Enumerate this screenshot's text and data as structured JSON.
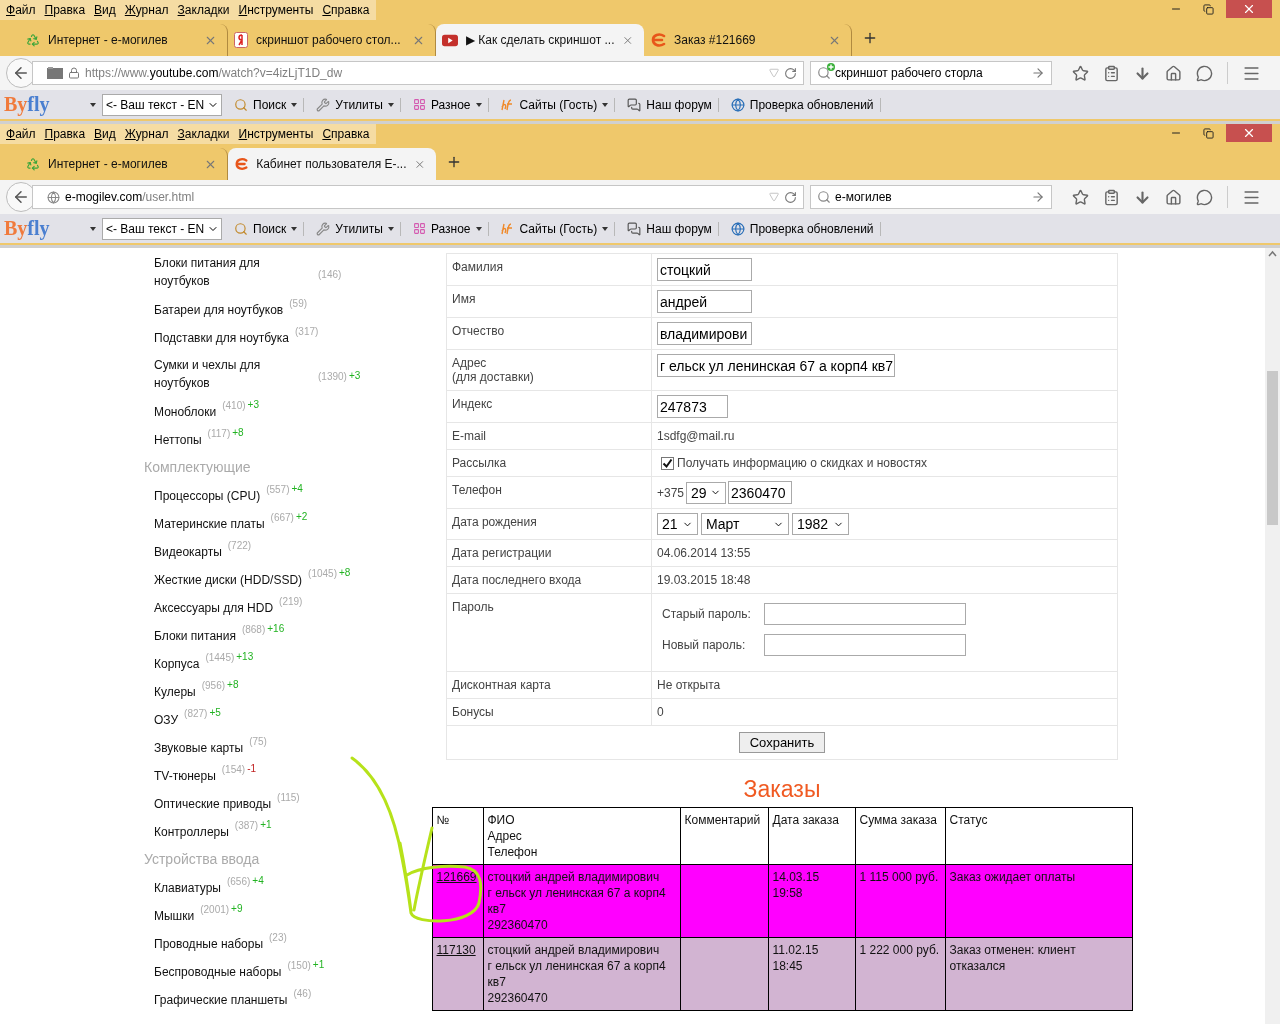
{
  "browsers": [
    {
      "menu": [
        "Файл",
        "Правка",
        "Вид",
        "Журнал",
        "Закладки",
        "Инструменты",
        "Справка"
      ],
      "tabs": [
        {
          "title": "Интернет - е-могилев",
          "kind": "recycle",
          "selected": false
        },
        {
          "title": "скриншот рабочего стол...",
          "kind": "yandex",
          "selected": false
        },
        {
          "title": "▶ Как сделать скриншот ...",
          "kind": "video",
          "selected": true
        },
        {
          "title": "Заказ #121669",
          "kind": "shop",
          "selected": false
        }
      ],
      "address": {
        "kind": "secure",
        "prefix": "https://www.",
        "host": "youtube.com",
        "path": "/watch?v=4izLjT1D_dw"
      },
      "search": {
        "kind": "add",
        "value": "скриншот рабочего сторла"
      },
      "bookmarks": {
        "logo": [
          "By",
          "fly"
        ],
        "select": "<- Ваш текст - EN",
        "items": [
          {
            "label": "Поиск",
            "kind": "search",
            "dropdown": true
          },
          {
            "label": "Утилиты",
            "kind": "tools",
            "dropdown": true
          },
          {
            "label": "Разное",
            "kind": "grid",
            "dropdown": true
          },
          {
            "label": "Сайты (Гость)",
            "kind": "bf",
            "dropdown": true
          },
          {
            "label": "Наш форум",
            "kind": "chat",
            "dropdown": false
          },
          {
            "label": "Проверка обновлений",
            "kind": "globe",
            "dropdown": false
          }
        ]
      }
    },
    {
      "menu": [
        "Файл",
        "Правка",
        "Вид",
        "Журнал",
        "Закладки",
        "Инструменты",
        "Справка"
      ],
      "tabs": [
        {
          "title": "Интернет - е-могилев",
          "kind": "recycle",
          "selected": false
        },
        {
          "title": "Кабинет пользователя Е-...",
          "kind": "shop",
          "selected": true
        }
      ],
      "address": {
        "kind": "plain",
        "host": "e-mogilev.com",
        "path": "/user.html"
      },
      "search": {
        "kind": "plain",
        "value": "е-могилев"
      },
      "bookmarks": {
        "logo": [
          "By",
          "fly"
        ],
        "select": "<- Ваш текст - EN",
        "items": [
          {
            "label": "Поиск",
            "kind": "search",
            "dropdown": true
          },
          {
            "label": "Утилиты",
            "kind": "tools",
            "dropdown": true
          },
          {
            "label": "Разное",
            "kind": "grid",
            "dropdown": true
          },
          {
            "label": "Сайты (Гость)",
            "kind": "bf",
            "dropdown": true
          },
          {
            "label": "Наш форум",
            "kind": "chat",
            "dropdown": false
          },
          {
            "label": "Проверка обновлений",
            "kind": "globe",
            "dropdown": false
          }
        ]
      }
    }
  ],
  "sidebar": [
    {
      "items": [
        {
          "name": "Блоки питания для ноутбуков",
          "count": "(146)"
        },
        {
          "name": "Батареи для ноутбуков",
          "count": "(59)"
        },
        {
          "name": "Подставки для ноутбука",
          "count": "(317)"
        },
        {
          "name": "Сумки и чехлы для ноутбуков",
          "count": "(1390)",
          "delta": "+3",
          "kind": "up"
        },
        {
          "name": "Моноблоки",
          "count": "(410)",
          "delta": "+3",
          "kind": "up"
        },
        {
          "name": "Неттопы",
          "count": "(117)",
          "delta": "+8",
          "kind": "up"
        }
      ]
    },
    {
      "title": "Комплектующие",
      "items": [
        {
          "name": "Процессоры (CPU)",
          "count": "(557)",
          "delta": "+4",
          "kind": "up"
        },
        {
          "name": "Материнские платы",
          "count": "(667)",
          "delta": "+2",
          "kind": "up"
        },
        {
          "name": "Видеокарты",
          "count": "(722)"
        },
        {
          "name": "Жесткие диски (HDD/SSD)",
          "count": "(1045)",
          "delta": "+8",
          "kind": "up"
        },
        {
          "name": "Аксессуары для HDD",
          "count": "(219)"
        },
        {
          "name": "Блоки питания",
          "count": "(868)",
          "delta": "+16",
          "kind": "up"
        },
        {
          "name": "Корпуса",
          "count": "(1445)",
          "delta": "+13",
          "kind": "up"
        },
        {
          "name": "Кулеры",
          "count": "(956)",
          "delta": "+8",
          "kind": "up"
        },
        {
          "name": "ОЗУ",
          "count": "(827)",
          "delta": "+5",
          "kind": "up"
        },
        {
          "name": "Звуковые карты",
          "count": "(75)"
        },
        {
          "name": "TV-тюнеры",
          "count": "(154)",
          "delta": "-1",
          "kind": "down"
        },
        {
          "name": "Оптические приводы",
          "count": "(115)"
        },
        {
          "name": "Контроллеры",
          "count": "(387)",
          "delta": "+1",
          "kind": "up"
        }
      ]
    },
    {
      "title": "Устройства ввода",
      "items": [
        {
          "name": "Клавиатуры",
          "count": "(656)",
          "delta": "+4",
          "kind": "up"
        },
        {
          "name": "Мышки",
          "count": "(2001)",
          "delta": "+9",
          "kind": "up"
        },
        {
          "name": "Проводные наборы",
          "count": "(23)"
        },
        {
          "name": "Беспроводные наборы",
          "count": "(150)",
          "delta": "+1",
          "kind": "up"
        },
        {
          "name": "Графические планшеты",
          "count": "(46)"
        }
      ]
    }
  ],
  "profile": {
    "rows": [
      {
        "label": "Фамилия",
        "kind": "name-input",
        "value": "стоцкий"
      },
      {
        "label": "Имя",
        "kind": "name-input",
        "value": "андрей"
      },
      {
        "label": "Отчество",
        "kind": "name-input",
        "value": "владимирови"
      },
      {
        "label": "Адрес",
        "note": "(для доставки)",
        "kind": "address-input",
        "value": "г ельск ул ленинская 67 а корп4 кв7"
      },
      {
        "label": "Индекс",
        "kind": "index-input",
        "value": "247873"
      },
      {
        "label": "E-mail",
        "kind": "text",
        "value": "1sdfg@mail.ru"
      },
      {
        "label": "Рассылка",
        "kind": "checkbox",
        "value": "Получать информацию о скидках и новостях",
        "checked": true
      },
      {
        "label": "Телефон",
        "kind": "phone",
        "prefix": "+375",
        "code": "29",
        "number": "2360470"
      },
      {
        "label": "Дата рождения",
        "kind": "date",
        "day": "21",
        "month": "Март",
        "year": "1982"
      },
      {
        "label": "Дата регистрации",
        "kind": "text",
        "value": "04.06.2014 13:55"
      },
      {
        "label": "Дата последнего входа",
        "kind": "text",
        "value": "19.03.2015 18:48"
      },
      {
        "label": "Пароль",
        "kind": "password",
        "fields": [
          "Старый пароль:",
          "Новый пароль:"
        ]
      },
      {
        "label": "Дисконтная карта",
        "kind": "text",
        "value": "Не открыта"
      },
      {
        "label": "Бонусы",
        "kind": "text",
        "value": "0"
      }
    ],
    "save": "Сохранить"
  },
  "orders": {
    "title": "Заказы",
    "columns": [
      [
        "№"
      ],
      [
        "ФИО",
        "Адрес",
        "Телефон"
      ],
      [
        "Комментарий"
      ],
      [
        "Дата заказа"
      ],
      [
        "Сумма заказа"
      ],
      [
        "Статус"
      ]
    ],
    "rows": [
      {
        "number": "121669",
        "color": "#ff00ff",
        "client": [
          "стоцкий андрей владимирович",
          "г ельск ул ленинская 67 а корп4 кв7",
          "292360470"
        ],
        "date": [
          "14.03.15",
          "19:58"
        ],
        "sum": "1 115 000 руб.",
        "status": "Заказ ожидает оплаты"
      },
      {
        "number": "117130",
        "color": "#d2b4d2",
        "client": [
          "стоцкий андрей владимирович",
          "г ельск ул ленинская 67 а корп4 кв7",
          "292360470"
        ],
        "date": [
          "11.02.15",
          "18:45"
        ],
        "sum": "1 222 000 руб.",
        "status": "Заказ отменен: клиент отказался"
      }
    ]
  }
}
